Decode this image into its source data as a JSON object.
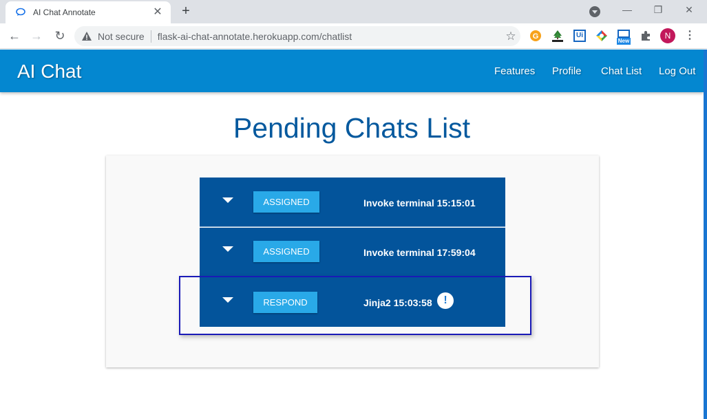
{
  "browser": {
    "tab_title": "AI Chat Annotate",
    "tab_close": "✕",
    "new_tab": "+",
    "not_secure": "Not secure",
    "url": "flask-ai-chat-annotate.herokuapp.com/chatlist",
    "profile_initial": "N",
    "extensions": [
      "g-icon",
      "html-icon",
      "ui-icon",
      "color-icon",
      "new-badge-icon",
      "puzzle-icon"
    ],
    "ext_ui_label": "Ui",
    "ext_new_label": "New"
  },
  "header": {
    "brand": "AI Chat",
    "nav": [
      "Features",
      "Profile",
      "Chat List",
      "Log Out"
    ],
    "color": "#0487d0"
  },
  "main": {
    "title": "Pending Chats List",
    "chats": [
      {
        "status": "ASSIGNED",
        "title": "Invoke terminal 15:15:01",
        "alert": false
      },
      {
        "status": "ASSIGNED",
        "title": "Invoke terminal 17:59:04",
        "alert": false
      },
      {
        "status": "RESPOND",
        "title": "Jinja2 15:03:58",
        "alert": true,
        "alert_symbol": "!"
      }
    ]
  },
  "colors": {
    "row": "#03549b",
    "button": "#29a9e8",
    "title": "#05599e",
    "highlight": "#1a1ab7"
  }
}
